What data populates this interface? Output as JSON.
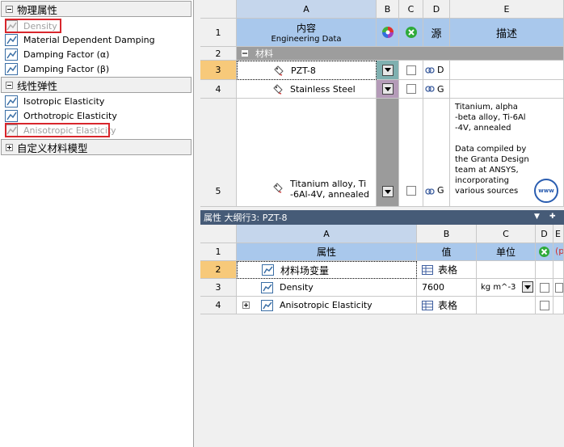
{
  "toolbox": {
    "groups": [
      {
        "label": "物理属性",
        "expanded": true
      },
      {
        "label": "线性弹性",
        "expanded": true
      },
      {
        "label": "自定义材料模型",
        "expanded": false
      }
    ],
    "physical_items": [
      "Density",
      "Material Dependent Damping",
      "Damping Factor (α)",
      "Damping Factor (β)"
    ],
    "linear_items": [
      "Isotropic Elasticity",
      "Orthotropic Elasticity",
      "Anisotropic Elasticity"
    ]
  },
  "outline": {
    "col_letters": [
      "A",
      "B",
      "C",
      "D",
      "E"
    ],
    "row_numbers": [
      "1",
      "2",
      "3",
      "4",
      "5"
    ],
    "header_contents": "内容",
    "header_engineering": "Engineering Data",
    "header_source": "源",
    "header_desc": "描述",
    "section_label": "材料",
    "materials": [
      {
        "name": "PZT-8",
        "source": "D"
      },
      {
        "name": "Stainless Steel",
        "source": "G"
      },
      {
        "name_line1": "Titanium alloy, Ti",
        "name_line2": "-6Al-4V, annealed",
        "source": "G"
      }
    ],
    "desc_lines": [
      "Titanium, alpha",
      "-beta alloy, Ti-6Al",
      "-4V, annealed"
    ],
    "desc_lines2": [
      "Data compiled by",
      "the Granta Design",
      "team at ANSYS,",
      "incorporating",
      "various sources"
    ],
    "www_label": "www"
  },
  "properties": {
    "title": "属性 大纲行3:  PZT-8",
    "col_letters": [
      "A",
      "B",
      "C",
      "D",
      "E"
    ],
    "row_numbers": [
      "1",
      "2",
      "3",
      "4"
    ],
    "header_property": "属性",
    "header_value": "值",
    "header_unit": "单位",
    "rows": [
      {
        "name": "材料场变量",
        "value": "表格"
      },
      {
        "name": "Density",
        "value": "7600",
        "unit": "kg m^-3"
      },
      {
        "name": "Anisotropic Elasticity",
        "value": "表格"
      }
    ],
    "e_header": "(p"
  }
}
